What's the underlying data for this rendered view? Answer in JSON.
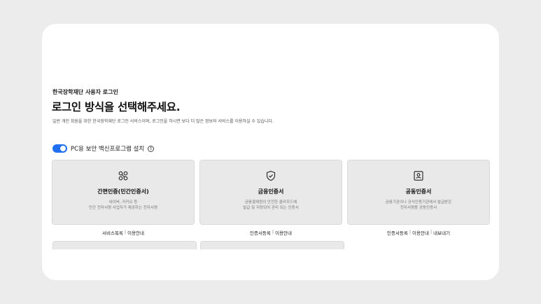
{
  "page": {
    "eyebrow": "한국장학재단 사용자 로그인",
    "title": "로그인 방식을 선택해주세요.",
    "description": "일반 개인 회원을 위한 한국장학재단 로그인 서비스이며, 로그인을 하시면 보다 더 많은 정보와 서비스를 이용하실 수 있습니다."
  },
  "security_toggle": {
    "label": "PC용 보안 백신프로그램 설치",
    "enabled": true,
    "info_icon": "info-circle-icon"
  },
  "methods": [
    {
      "icon": "link-chain-icon",
      "name": "간편인증(민간인증서)",
      "line1": "네이버, 카카오 등",
      "line2": "민간 전자서명 사업자가 제공하는 전자서명",
      "links": [
        "서비스목록",
        "이용안내"
      ]
    },
    {
      "icon": "shield-check-icon",
      "name": "금융인증서",
      "line1": "금융결제원의 안전한 클라우드에",
      "line2": "발급 및 저장되어 관리 되는 인증서",
      "links": [
        "인증서등록",
        "이용안내"
      ]
    },
    {
      "icon": "id-card-icon",
      "name": "공동인증서",
      "line1": "금융기관이나 공식인증기관에서 발급받은",
      "line2": "전자서명용 공동인증서",
      "links": [
        "인증서등록",
        "이용안내",
        "내보내기"
      ]
    }
  ],
  "colors": {
    "accent": "#1f6ff0",
    "card_bg": "#e9e9e9",
    "page_bg": "#ececec"
  }
}
